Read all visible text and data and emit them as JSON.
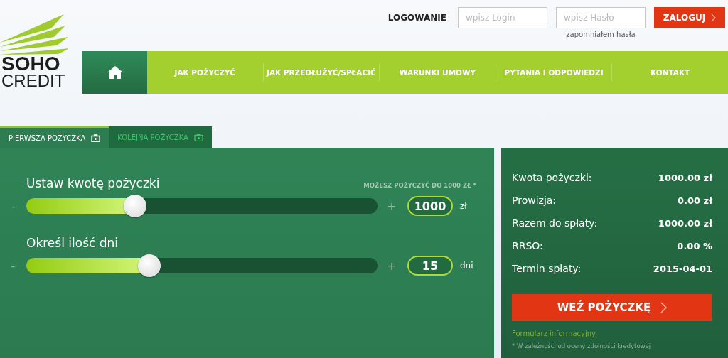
{
  "logo": {
    "line_1": "SOHO",
    "line_2": "CREDIT"
  },
  "login": {
    "label": "LOGOWANIE",
    "login_placeholder": "wpisz Login",
    "password_placeholder": "wpisz Hasło",
    "forgot_link": "zapomniałem hasła",
    "button": "ZALOGUJ"
  },
  "nav": {
    "items": [
      "JAK POŻYCZYĆ",
      "JAK PRZEDŁUŻYĆ/SPŁACIĆ",
      "WARUNKI UMOWY",
      "PYTANIA I ODPOWIEDZI",
      "KONTAKT"
    ]
  },
  "tabs": [
    {
      "label": "PIERWSZA POŻYCZKA",
      "selected": true
    },
    {
      "label": "KOLEJNA POŻYCZKA",
      "selected": false
    }
  ],
  "note": "MOŻESZ POŻYCZYĆ DO 1000 ZŁ *",
  "sliders": [
    {
      "label": "Ustaw kwotę pożyczki",
      "minus": "-",
      "plus": "+",
      "level": 0.31,
      "value": "1000",
      "unit": "zł"
    },
    {
      "label": "Określ ilość dni",
      "minus": "-",
      "plus": "+",
      "level": 0.35,
      "value": "15",
      "unit": "dni"
    }
  ],
  "summary": [
    {
      "label": "Kwota pożyczki:",
      "value": "1000.00 zł"
    },
    {
      "label": "Prowizja:",
      "value": "0.00 zł"
    },
    {
      "label": "Razem do spłaty:",
      "value": "1000.00 zł"
    },
    {
      "label": "RRSO:",
      "value": "0.00 %"
    },
    {
      "label": "Termin spłaty:",
      "value": "2015-04-01"
    }
  ],
  "apply_button": "WEŹ POŻYCZKĘ",
  "info_link": "Formularz informacyjny",
  "footnote": "* W zależności od oceny zdolności kredytowej"
}
